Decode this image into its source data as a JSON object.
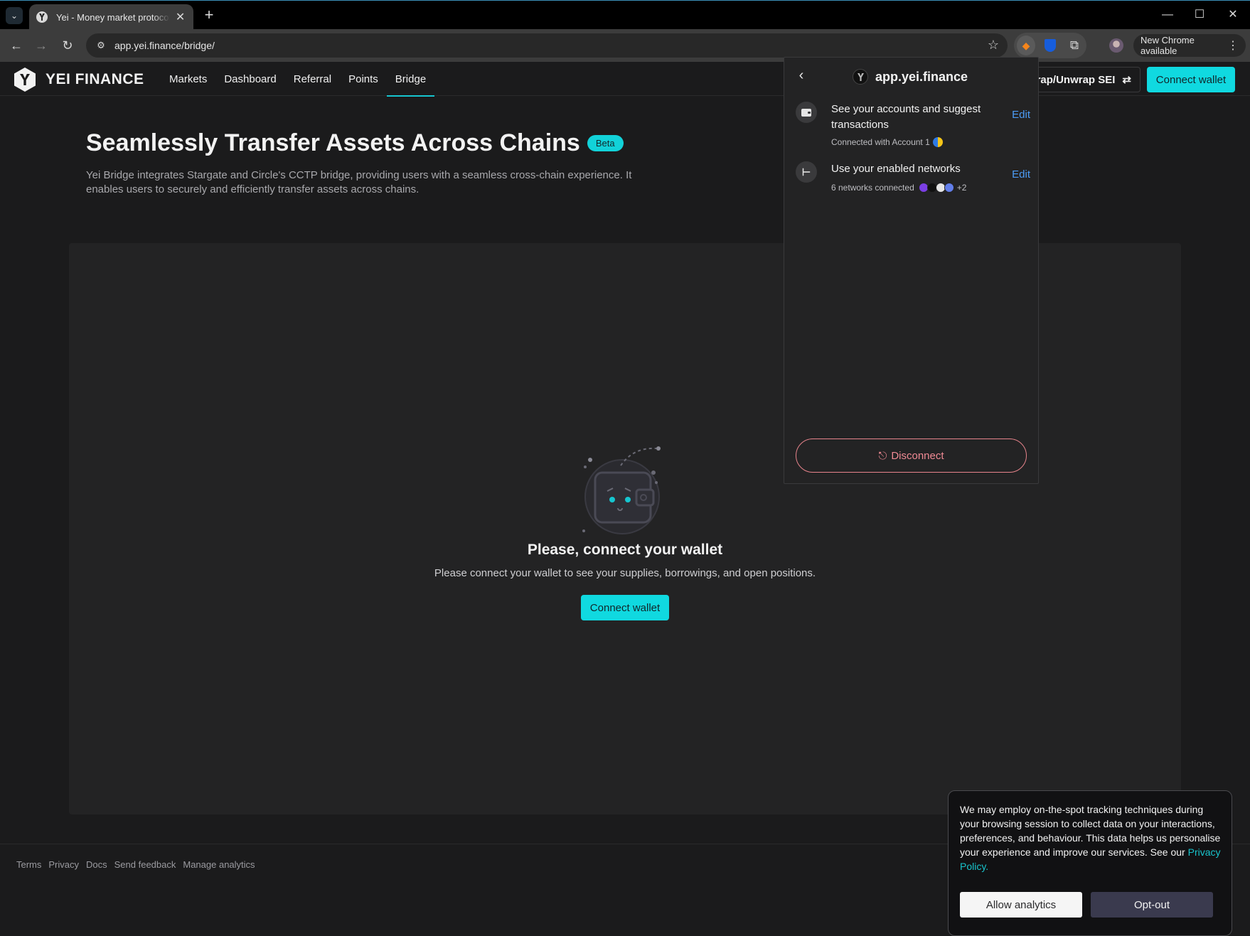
{
  "browser": {
    "tab_title": "Yei - Money market protocol on Sei",
    "url": "app.yei.finance/bridge/",
    "update_label": "New Chrome available"
  },
  "header": {
    "logo_text": "YEI FINANCE",
    "nav": [
      {
        "label": "Markets",
        "active": false
      },
      {
        "label": "Dashboard",
        "active": false
      },
      {
        "label": "Referral",
        "active": false
      },
      {
        "label": "Points",
        "active": false
      },
      {
        "label": "Bridge",
        "active": true
      }
    ],
    "wrap_label": "rap/Unwrap SEI",
    "connect_label": "Connect wallet"
  },
  "hero": {
    "title": "Seamlessly Transfer Assets Across Chains",
    "badge": "Beta",
    "description": "Yei Bridge integrates Stargate and Circle's CCTP bridge, providing users with a seamless cross-chain experience. It enables users to securely and efficiently transfer assets across chains."
  },
  "empty_state": {
    "title": "Please, connect your wallet",
    "subtitle": "Please connect your wallet to see your supplies, borrowings, and open positions.",
    "button": "Connect wallet"
  },
  "footer": {
    "links": [
      "Terms",
      "Privacy",
      "Docs",
      "Send feedback",
      "Manage analytics"
    ]
  },
  "popup": {
    "site": "app.yei.finance",
    "permissions": [
      {
        "title": "See your accounts and suggest transactions",
        "subtitle": "Connected with Account 1",
        "edit": "Edit"
      },
      {
        "title": "Use your enabled networks",
        "subtitle": "6 networks connected",
        "extra": "+2",
        "edit": "Edit"
      }
    ],
    "disconnect": "Disconnect"
  },
  "cookie": {
    "text": "We may employ on-the-spot tracking techniques during your browsing session to collect data on your interactions, preferences, and behaviour. This data helps us personalise your experience and improve our services. See our",
    "link": "Privacy Policy.",
    "allow": "Allow analytics",
    "optout": "Opt-out"
  },
  "colors": {
    "accent": "#10d9e0",
    "background": "#1b1b1c",
    "card": "#232324",
    "disconnect": "#f08a94",
    "link": "#4c9cf5"
  }
}
